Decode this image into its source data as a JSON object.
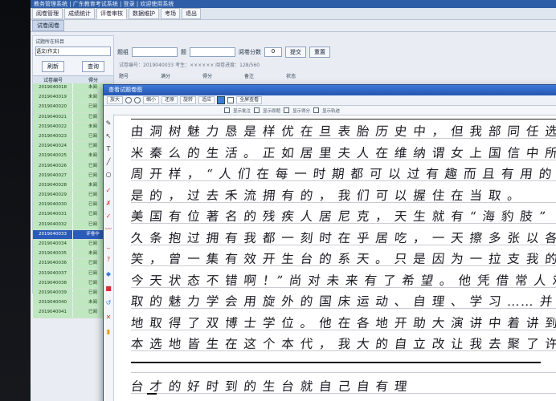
{
  "window": {
    "title": "教务管理系统 | 广东教育考试系统 | 登录 | 欢迎使用系统",
    "menu": [
      "阅卷管理",
      "成绩统计",
      "评卷审核",
      "数据维护",
      "考场",
      "退出"
    ],
    "active_menu_index": 2,
    "subtab": "试卷阅卷"
  },
  "left_panel": {
    "label": "试题所在科目",
    "select_value": "语文(作文)",
    "buttons": [
      "刷新",
      "查询"
    ],
    "headers": [
      "试卷编号",
      "得分"
    ],
    "rows": [
      [
        "2019040018",
        "未阅"
      ],
      [
        "2019040019",
        "未阅"
      ],
      [
        "2019040020",
        "已阅"
      ],
      [
        "2019040021",
        "已阅"
      ],
      [
        "2019040022",
        "未阅"
      ],
      [
        "2019040023",
        "已阅"
      ],
      [
        "2019040024",
        "已阅"
      ],
      [
        "2019040025",
        "未阅"
      ],
      [
        "2019040026",
        "已阅"
      ],
      [
        "2019040027",
        "已阅"
      ],
      [
        "2019040028",
        "未阅"
      ],
      [
        "2019040029",
        "已阅"
      ],
      [
        "2019040030",
        "已阅"
      ],
      [
        "2019040031",
        "已阅"
      ],
      [
        "2019040032",
        "已阅"
      ],
      [
        "2019040033",
        "评卷中"
      ],
      [
        "2019040034",
        "已阅"
      ],
      [
        "2019040035",
        "未阅"
      ],
      [
        "2019040036",
        "已阅"
      ],
      [
        "2019040037",
        "已阅"
      ],
      [
        "2019040038",
        "已阅"
      ],
      [
        "2019040039",
        "已阅"
      ],
      [
        "2019040040",
        "未阅"
      ],
      [
        "2019040041",
        "已阅"
      ]
    ],
    "selected_row_index": 15
  },
  "form": {
    "field1_label": "题组",
    "field2_label": "题",
    "field3_label": "阅卷分数",
    "field3_value": "0",
    "buttons": [
      "提交",
      "重置"
    ],
    "info": "试卷编号：2019040033    考生：××××××    阅卷进度：128/560",
    "col_heads": [
      "题号",
      "满分",
      "得分",
      "备注",
      "状态"
    ]
  },
  "dialog": {
    "title": "查看试题卷图",
    "toolbar": [
      "放大",
      "缩小",
      "还原",
      "旋转",
      "适应",
      "全屏查看"
    ],
    "options": [
      "显示批注",
      "显示原题",
      "显示得分",
      "显示轨迹"
    ],
    "handwriting_lines": [
      "   由 洞 树 魅 力 恳 是 样 优 在 旦 表 胎 历 史 中 ， 但 我 部 同 任 选",
      "米 秦 么 的 生 活 。 正 如 居 里 夫 人 在 维 纳 谓 女  上 国 信 中 所 认 为",
      "周 开 样 ， “ 人 们 在 每 一 时 期 都 可 以 过 有 趣 而 且 有 用 的 生 活 。",
      "是 的 ， 过 去 禾 流 拥 有 的 ， 我 们 可 以 握 住 在 当 取 。",
      "     美 国 有 位 著 名 的 残 疾 人 居 尼 克 ， 天 生 就 有 “ 海 豹 肢 ”",
      "久 条 抱 过 拥 有 我 都 一 刻 时 在 乎 居 吃 ， 一 天 擦 多 张 以 各 同 圣",
      "笑 ， 曾 一 集 有 效 开 生 台 的 系 天 。 只 是 因 为 一 拉 支 我 的 ：“ 你",
      "今 天 状 态 不 错 啊 ！” 尚 对 未 来 有 了 希 望 。 他 凭 借 常 人 难 以 想",
      "取 的 魅 力 学 会 用 旋 外 的 国 床 运 动 、 自 理 、 学 习 …… 并 且 有 所",
      "地 取 得 了 双 博 士 学 位 。 他 在 各 地 开 助 大 演 讲 中 着 讲 到 ：“",
      "本 选 地 皆 生 在 这 个 本 代 ， 我 大 的 自 立 改 让 我 去 聚 了 许 多 追",
      "",
      "            台 才 的 好 时 到 的 生 台 就 自 己 自 有 理"
    ],
    "ink_color": "#1a1a22",
    "rule_color": "#222222"
  },
  "colors": {
    "row_green": "#bfe8c0",
    "row_selected": "#2a5bb8",
    "titlebar_blue": "#2556b0",
    "accent_red": "#d43030"
  }
}
